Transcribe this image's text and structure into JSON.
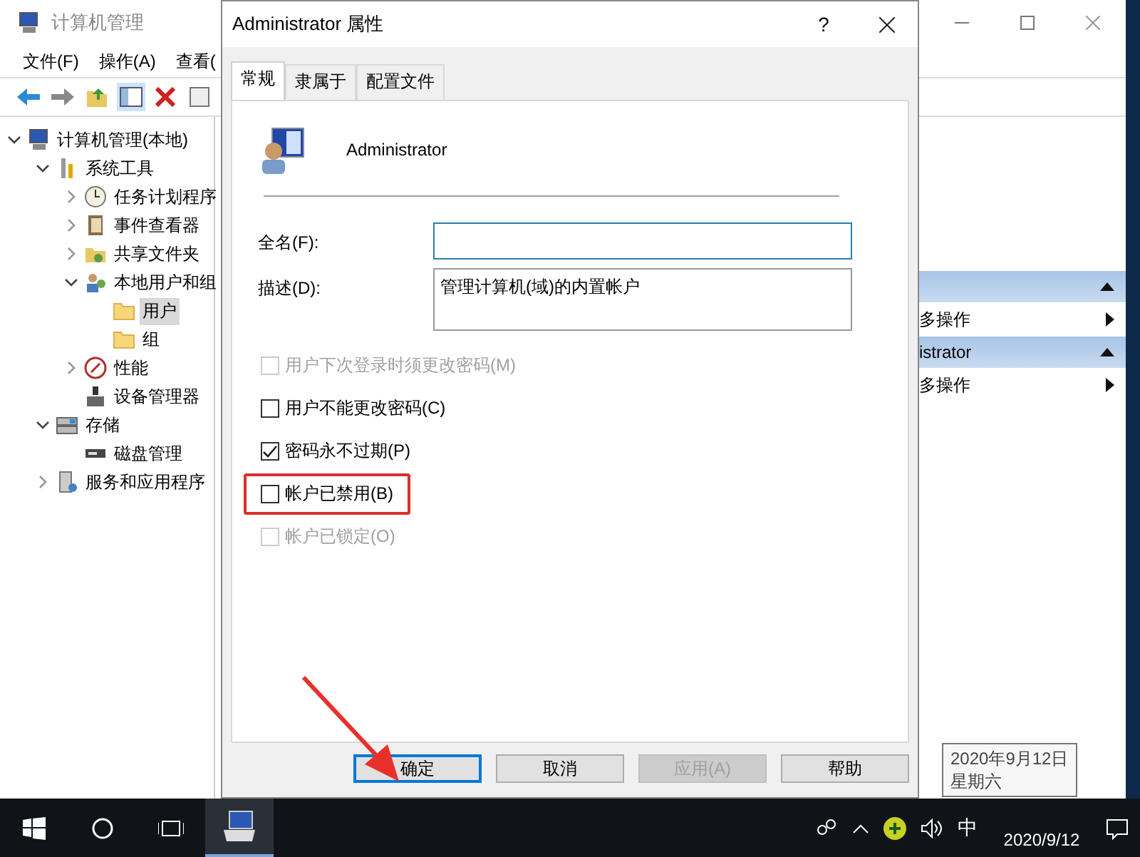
{
  "window": {
    "title": "计算机管理",
    "menu": [
      "文件(F)",
      "操作(A)",
      "查看("
    ]
  },
  "tree": [
    {
      "label": "计算机管理(本地)",
      "kind": "computer",
      "selected": false,
      "expanded": true,
      "children": [
        {
          "label": "系统工具",
          "kind": "tools",
          "selected": false,
          "expanded": true,
          "children": [
            {
              "label": "任务计划程序",
              "kind": "clock",
              "selected": false,
              "expanded": false
            },
            {
              "label": "事件查看器",
              "kind": "log",
              "selected": false,
              "expanded": false
            },
            {
              "label": "共享文件夹",
              "kind": "share",
              "selected": false,
              "expanded": false
            },
            {
              "label": "本地用户和组",
              "kind": "users",
              "selected": false,
              "expanded": true,
              "children": [
                {
                  "label": "用户",
                  "kind": "folder",
                  "selected": true
                },
                {
                  "label": "组",
                  "kind": "folder",
                  "selected": false
                }
              ]
            },
            {
              "label": "性能",
              "kind": "perf",
              "selected": false,
              "expanded": false
            },
            {
              "label": "设备管理器",
              "kind": "device",
              "selected": false
            }
          ]
        },
        {
          "label": "存储",
          "kind": "storage",
          "selected": false,
          "expanded": true,
          "children": [
            {
              "label": "磁盘管理",
              "kind": "disk",
              "selected": false
            }
          ]
        },
        {
          "label": "服务和应用程序",
          "kind": "services",
          "selected": false,
          "expanded": false
        }
      ]
    }
  ],
  "actions": [
    {
      "kind": "header"
    },
    {
      "kind": "item",
      "label": "多操作"
    },
    {
      "kind": "header",
      "label": "istrator"
    },
    {
      "kind": "item",
      "label": "多操作"
    }
  ],
  "dialog": {
    "title": "Administrator 属性",
    "help": "?",
    "tabs": [
      {
        "label": "常规",
        "selected": true
      },
      {
        "label": "隶属于",
        "selected": false
      },
      {
        "label": "配置文件",
        "selected": false
      }
    ],
    "user_name": "Administrator",
    "full_name": {
      "label": "全名(F):"
    },
    "description": {
      "label": "描述(D):",
      "value": "管理计算机(域)的内置帐户"
    },
    "options": [
      {
        "label": "用户下次登录时须更改密码(M)",
        "checked": false,
        "disabled": true,
        "highlighted": false
      },
      {
        "label": "用户不能更改密码(C)",
        "checked": false,
        "disabled": false,
        "highlighted": false
      },
      {
        "label": "密码永不过期(P)",
        "checked": true,
        "disabled": false,
        "highlighted": false
      },
      {
        "label": "帐户已禁用(B)",
        "checked": false,
        "disabled": false,
        "highlighted": true
      },
      {
        "label": "帐户已锁定(O)",
        "checked": false,
        "disabled": true,
        "highlighted": false
      }
    ],
    "buttons": [
      {
        "label": "确定",
        "default": true,
        "disabled": false
      },
      {
        "label": "取消",
        "default": false,
        "disabled": false
      },
      {
        "label": "应用(A)",
        "default": false,
        "disabled": true
      },
      {
        "label": "帮助",
        "default": false,
        "disabled": false
      }
    ]
  },
  "tooltip": [
    "2020年9月12日",
    "星期六"
  ],
  "taskbar": {
    "ime": "中",
    "date": "2020/9/12"
  }
}
